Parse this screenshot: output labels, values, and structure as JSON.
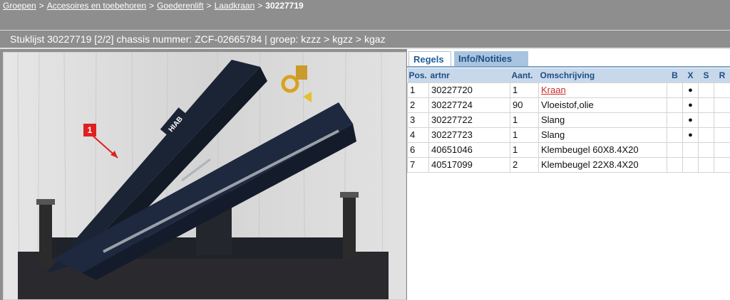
{
  "breadcrumb": {
    "items": [
      "Groepen",
      "Accesoires en toebehoren",
      "Goederenlift",
      "Laadkraan"
    ],
    "separator": ">",
    "current": "30227719"
  },
  "header": {
    "text": "Stuklijst  30227719 [2/2]   chassis nummer: ZCF-02665784 | groep: kzzz > kgzz > kgaz"
  },
  "image": {
    "callout_number": "1",
    "callout_color": "#e02020"
  },
  "tabs": {
    "regels": "Regels",
    "info": "Info/Notities"
  },
  "table": {
    "headers": {
      "pos": "Pos.",
      "artnr": "artnr",
      "aant": "Aant.",
      "omschrijving": "Omschrijving",
      "b": "B",
      "x": "X",
      "s": "S",
      "r": "R"
    },
    "rows": [
      {
        "pos": "1",
        "artnr": "30227720",
        "aant": "1",
        "omschrijving": "Kraan",
        "b": "",
        "x": "●",
        "s": "",
        "r": ""
      },
      {
        "pos": "2",
        "artnr": "30227724",
        "aant": "90",
        "omschrijving": "Vloeistof,olie",
        "b": "",
        "x": "●",
        "s": "",
        "r": ""
      },
      {
        "pos": "3",
        "artnr": "30227722",
        "aant": "1",
        "omschrijving": "Slang",
        "b": "",
        "x": "●",
        "s": "",
        "r": ""
      },
      {
        "pos": "4",
        "artnr": "30227723",
        "aant": "1",
        "omschrijving": "Slang",
        "b": "",
        "x": "●",
        "s": "",
        "r": ""
      },
      {
        "pos": "6",
        "artnr": "40651046",
        "aant": "1",
        "omschrijving": "Klembeugel 60X8.4X20",
        "b": "",
        "x": "",
        "s": "",
        "r": ""
      },
      {
        "pos": "7",
        "artnr": "40517099",
        "aant": "2",
        "omschrijving": "Klembeugel 22X8.4X20",
        "b": "",
        "x": "",
        "s": "",
        "r": ""
      }
    ]
  }
}
